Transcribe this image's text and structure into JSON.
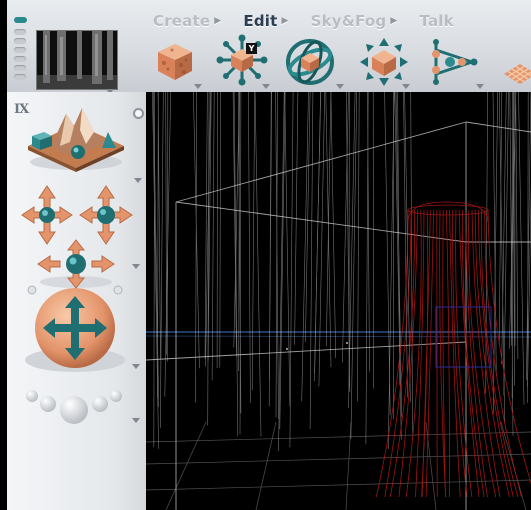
{
  "app": {
    "tabs": [
      {
        "label": "Create",
        "active": false
      },
      {
        "label": "Edit",
        "active": true
      },
      {
        "label": "Sky&Fog",
        "active": false
      },
      {
        "label": "Talk",
        "active": false
      }
    ],
    "side_label": "IX"
  },
  "toolbar": {
    "tools": [
      {
        "name": "texture-cube-tool",
        "badge": ""
      },
      {
        "name": "axis-constrain-tool",
        "badge": "Y"
      },
      {
        "name": "rotate-tool",
        "badge": ""
      },
      {
        "name": "scale-tool",
        "badge": ""
      },
      {
        "name": "link-tool",
        "badge": ""
      },
      {
        "name": "tile-tool",
        "badge": ""
      }
    ]
  },
  "colors": {
    "accent_teal": "#1f6e72",
    "object_orange": "#e3946a",
    "selection_red": "#b01818",
    "wire_gray": "#9a9a9a",
    "grid_blue": "#2c4f8a"
  }
}
